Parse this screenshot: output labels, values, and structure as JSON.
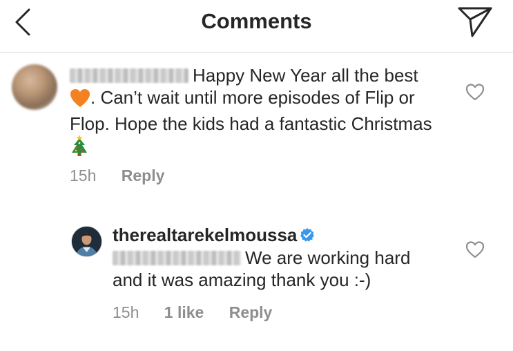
{
  "header": {
    "title": "Comments"
  },
  "comments": [
    {
      "text_1": "Happy New Year all the best",
      "text_2": ". Can’t wait until more episodes of Flip or Flop. Hope the kids had a fantastic Christmas",
      "time": "15h",
      "reply_label": "Reply"
    }
  ],
  "reply": {
    "username": "therealtarekelmoussa",
    "text": "We are working hard and it was amazing thank you :-)",
    "time": "15h",
    "likes": "1 like",
    "reply_label": "Reply"
  },
  "colors": {
    "text": "#262626",
    "muted": "#8e8e8e",
    "divider": "#dbdbdb",
    "verified": "#3897f0",
    "heart_emoji": "#f58220"
  },
  "icons": [
    "back-icon",
    "send-icon",
    "heart-icon",
    "verified-badge-icon",
    "orange-heart-emoji",
    "christmas-tree-emoji"
  ]
}
